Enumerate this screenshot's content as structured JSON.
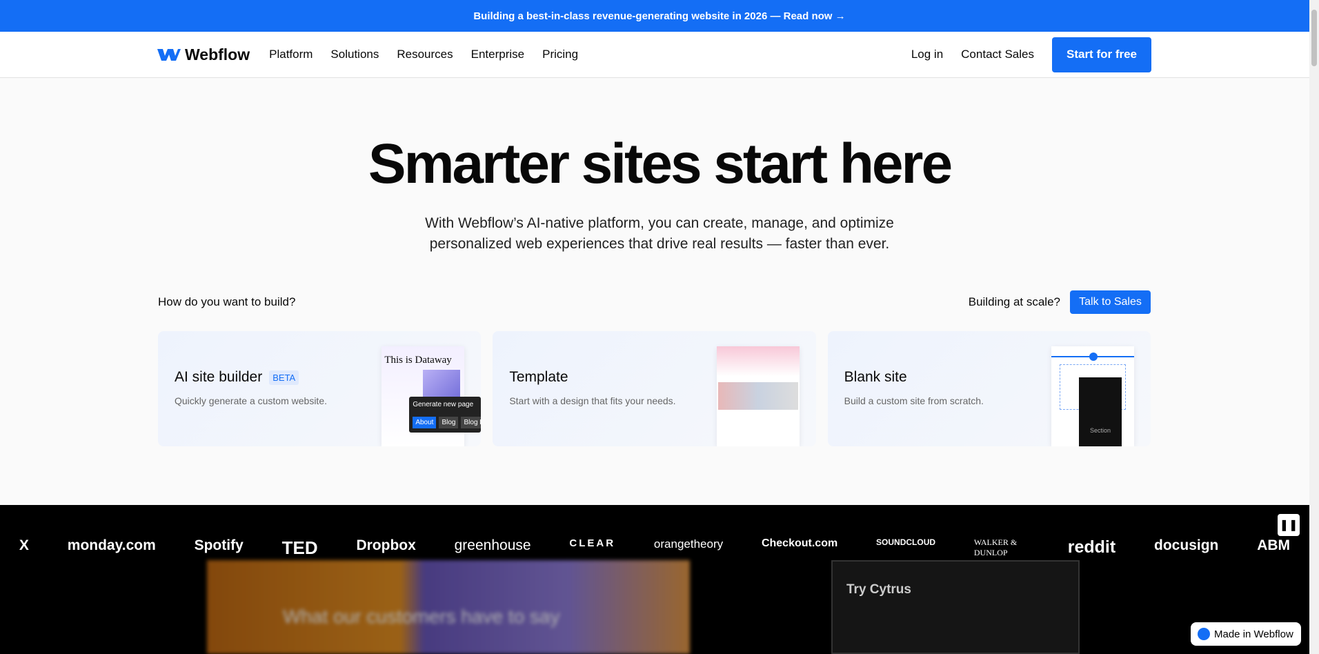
{
  "banner": {
    "text": "Building a best-in-class revenue-generating website in 2026 — Read now →"
  },
  "nav": {
    "brand": "Webflow",
    "items": [
      "Platform",
      "Solutions",
      "Resources",
      "Enterprise",
      "Pricing"
    ],
    "login": "Log in",
    "contact": "Contact Sales",
    "start": "Start for free"
  },
  "hero": {
    "title": "Smarter sites start here",
    "subtitle_1": "With Webflow’s AI-native platform, you can create, manage, and optimize",
    "subtitle_2": "personalized web experiences that drive real results — faster than ever."
  },
  "build": {
    "question": "How do you want to build?",
    "scale": "Building at scale?",
    "talk": "Talk to Sales"
  },
  "cards": [
    {
      "title": "AI site builder",
      "badge": "BETA",
      "desc": "Quickly generate a custom website.",
      "preview_title": "This is Dataway",
      "popup": "Generate new page",
      "chips": [
        "About",
        "Blog",
        "Blog Post"
      ]
    },
    {
      "title": "Template",
      "desc": "Start with a design that fits your needs."
    },
    {
      "title": "Blank site",
      "desc": "Build a custom site from scratch.",
      "preview_label": "Section"
    }
  ],
  "logos": [
    "X",
    "monday.com",
    "Spotify",
    "TED",
    "Dropbox",
    "greenhouse",
    "CLEAR",
    "orangetheory",
    "Checkout.com",
    "SOUNDCLOUD",
    "WALKER & DUNLOP",
    "reddit",
    "docusign",
    "ABM"
  ],
  "showcase": {
    "left": "What our customers have to say",
    "right": "Try Cytrus"
  },
  "badge": {
    "made": "Made in Webflow"
  },
  "colors": {
    "accent": "#146ef5"
  }
}
